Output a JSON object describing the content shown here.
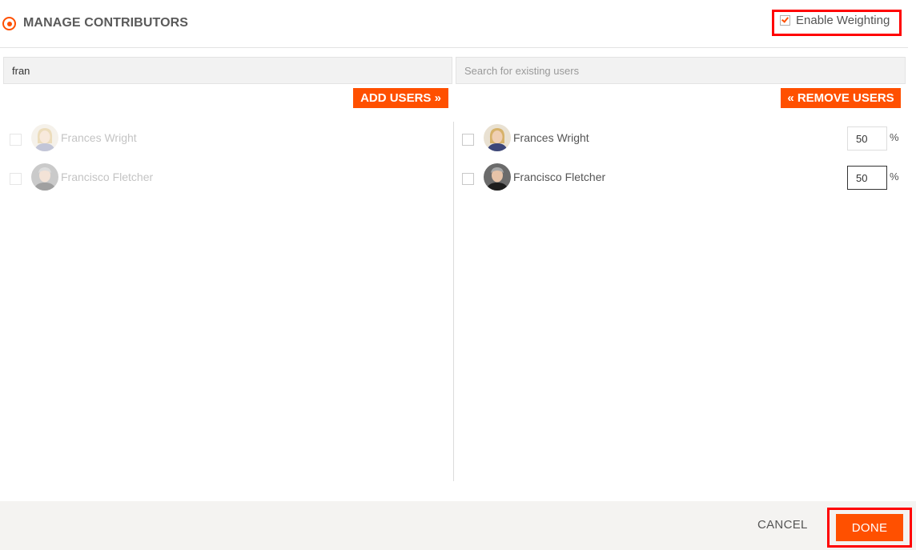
{
  "header": {
    "title": "MANAGE CONTRIBUTORS",
    "weighting_label": "Enable Weighting",
    "weighting_enabled": true
  },
  "search": {
    "left_value": "fran",
    "right_placeholder": "Search for existing users"
  },
  "actions": {
    "add_label": "ADD USERS",
    "add_glyph": "»",
    "remove_label": "REMOVE USERS",
    "remove_glyph": "«"
  },
  "available_users": [
    {
      "name": "Frances Wright",
      "checked": false
    },
    {
      "name": "Francisco Fletcher",
      "checked": false
    }
  ],
  "selected_users": [
    {
      "name": "Frances Wright",
      "checked": false,
      "weight": "50"
    },
    {
      "name": "Francisco Fletcher",
      "checked": false,
      "weight": "50"
    }
  ],
  "weight_unit": "%",
  "footer": {
    "cancel_label": "CANCEL",
    "done_label": "DONE"
  },
  "colors": {
    "accent": "#ff5000",
    "highlight": "#ff0000",
    "footer_bg": "#f4f3f1"
  }
}
